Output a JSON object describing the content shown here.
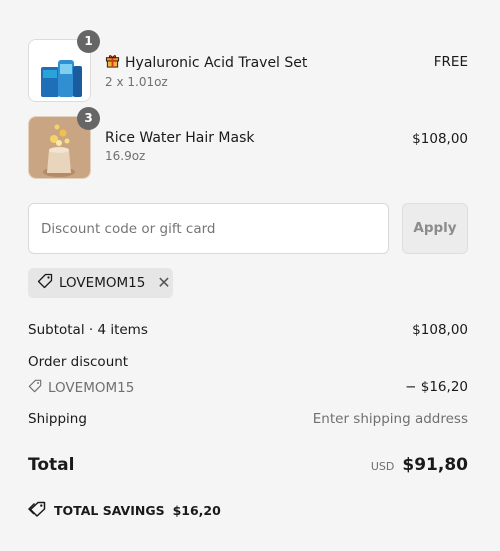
{
  "line_items": [
    {
      "quantity": "1",
      "gift_icon": "gift-icon",
      "title": "Hyaluronic Acid Travel Set",
      "variant": "2 x 1.01oz",
      "price": "FREE"
    },
    {
      "quantity": "3",
      "title": "Rice Water Hair Mask",
      "variant": "16.9oz",
      "price": "$108,00"
    }
  ],
  "discount": {
    "placeholder": "Discount code or gift card",
    "apply_label": "Apply",
    "applied_code": "LOVEMOM15"
  },
  "summary": {
    "subtotal_label": "Subtotal · 4 items",
    "subtotal_value": "$108,00",
    "order_discount_label": "Order discount",
    "discount_code": "LOVEMOM15",
    "discount_value": "− $16,20",
    "shipping_label": "Shipping",
    "shipping_value": "Enter shipping address",
    "total_label": "Total",
    "currency": "USD",
    "total_value": "$91,80",
    "savings_label": "TOTAL SAVINGS",
    "savings_value": "$16,20"
  },
  "colors": {
    "badge": "#666666",
    "background": "#f5f5f5",
    "muted_text": "#707070"
  }
}
